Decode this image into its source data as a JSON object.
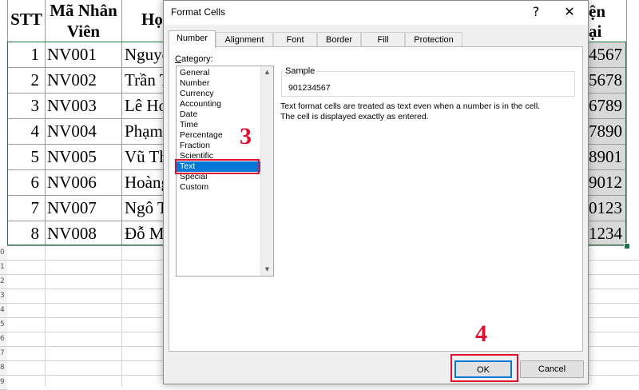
{
  "spreadsheet": {
    "headers": {
      "stt": "STT",
      "ma_line1": "Mã Nhân",
      "ma_line2": "Viên",
      "ho": "Họ",
      "tel_line1": "ện",
      "tel_line2": "ại"
    },
    "rows": [
      {
        "stt": "1",
        "code": "NV001",
        "name": "Nguyễ",
        "phone": "4567"
      },
      {
        "stt": "2",
        "code": "NV002",
        "name": "Trần T",
        "phone": "5678"
      },
      {
        "stt": "3",
        "code": "NV003",
        "name": "Lê Hoà",
        "phone": "6789"
      },
      {
        "stt": "4",
        "code": "NV004",
        "name": "Phạm",
        "phone": "7890"
      },
      {
        "stt": "5",
        "code": "NV005",
        "name": "Vũ Th",
        "phone": "8901"
      },
      {
        "stt": "6",
        "code": "NV006",
        "name": "Hoàng",
        "phone": "9012"
      },
      {
        "stt": "7",
        "code": "NV007",
        "name": "Ngô T",
        "phone": "0123"
      },
      {
        "stt": "8",
        "code": "NV008",
        "name": "Đỗ M",
        "phone": "1234"
      }
    ],
    "row_numbers": [
      "0",
      "1",
      "2",
      "3",
      "4",
      "5",
      "6",
      "7",
      "8",
      "9",
      "0"
    ]
  },
  "dialog": {
    "title": "Format Cells",
    "help_glyph": "?",
    "close_glyph": "✕",
    "tabs": [
      "Number",
      "Alignment",
      "Font",
      "Border",
      "Fill",
      "Protection"
    ],
    "active_tab": "Number",
    "category_label_underlined": "C",
    "category_label_rest": "ategory:",
    "categories": [
      "General",
      "Number",
      "Currency",
      "Accounting",
      "Date",
      "Time",
      "Percentage",
      "Fraction",
      "Scientific",
      "Text",
      "Special",
      "Custom"
    ],
    "selected_category": "Text",
    "sample_label": "Sample",
    "sample_value": "901234567",
    "description_line1": "Text format cells are treated as text even when a number is in the cell.",
    "description_line2": "The cell is displayed exactly as entered.",
    "ok_label": "OK",
    "cancel_label": "Cancel"
  },
  "annotations": {
    "step_select": "3",
    "step_ok": "4",
    "color": "#e0102e"
  },
  "colors": {
    "accent": "#0078d7",
    "selection_border": "#217346"
  }
}
